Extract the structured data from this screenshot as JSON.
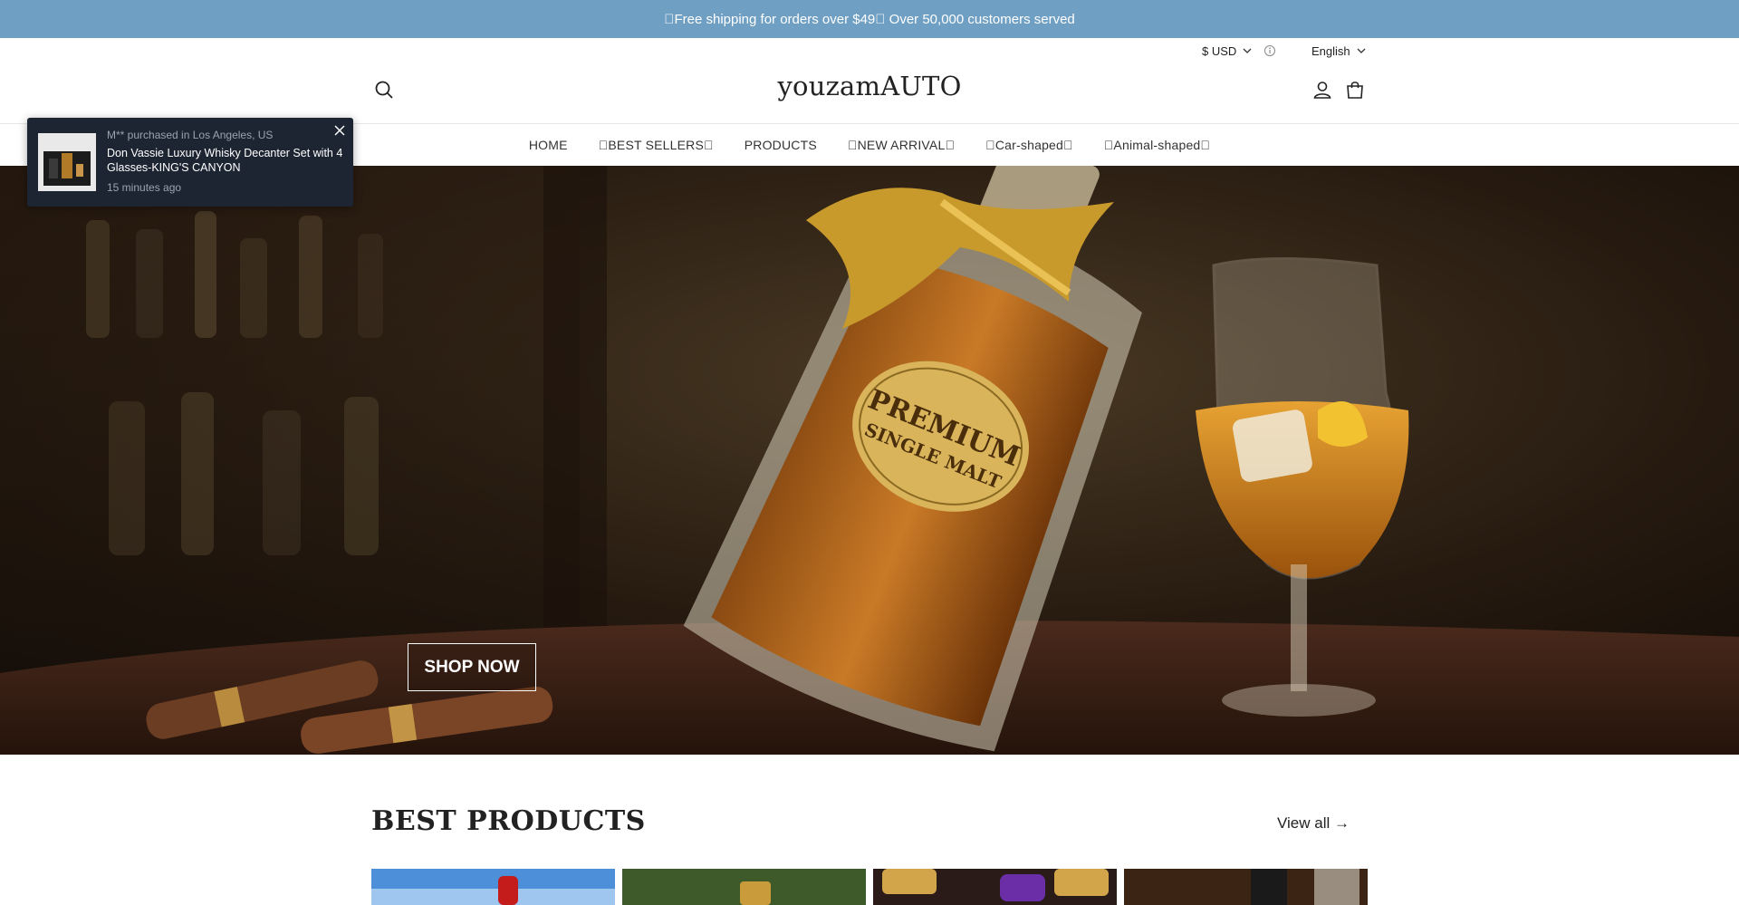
{
  "announcement": "\u0000Free shipping for orders over $49\u0000 Over 50,000 customers served",
  "topbar": {
    "currency": "$ USD",
    "language": "English"
  },
  "header": {
    "logo": "youzamAUTO"
  },
  "nav": {
    "items": [
      "HOME",
      "\u0000BEST SELLERS\u0000",
      "PRODUCTS",
      "\u0000NEW ARRIVAL\u0000",
      "\u0000Car-shaped\u0000",
      "\u0000Animal-shaped\u0000"
    ]
  },
  "hero": {
    "cta": "SHOP NOW"
  },
  "popup": {
    "meta": "M** purchased in Los Angeles, US",
    "product": "Don Vassie Luxury Whisky Decanter Set with 4 Glasses-KING'S CANYON",
    "time": "15 minutes ago"
  },
  "best_products": {
    "title": "BEST PRODUCTS",
    "view_all": "View all →"
  },
  "colors": {
    "announcement_bg": "#6f9fc3",
    "popup_bg": "#1d2533"
  }
}
